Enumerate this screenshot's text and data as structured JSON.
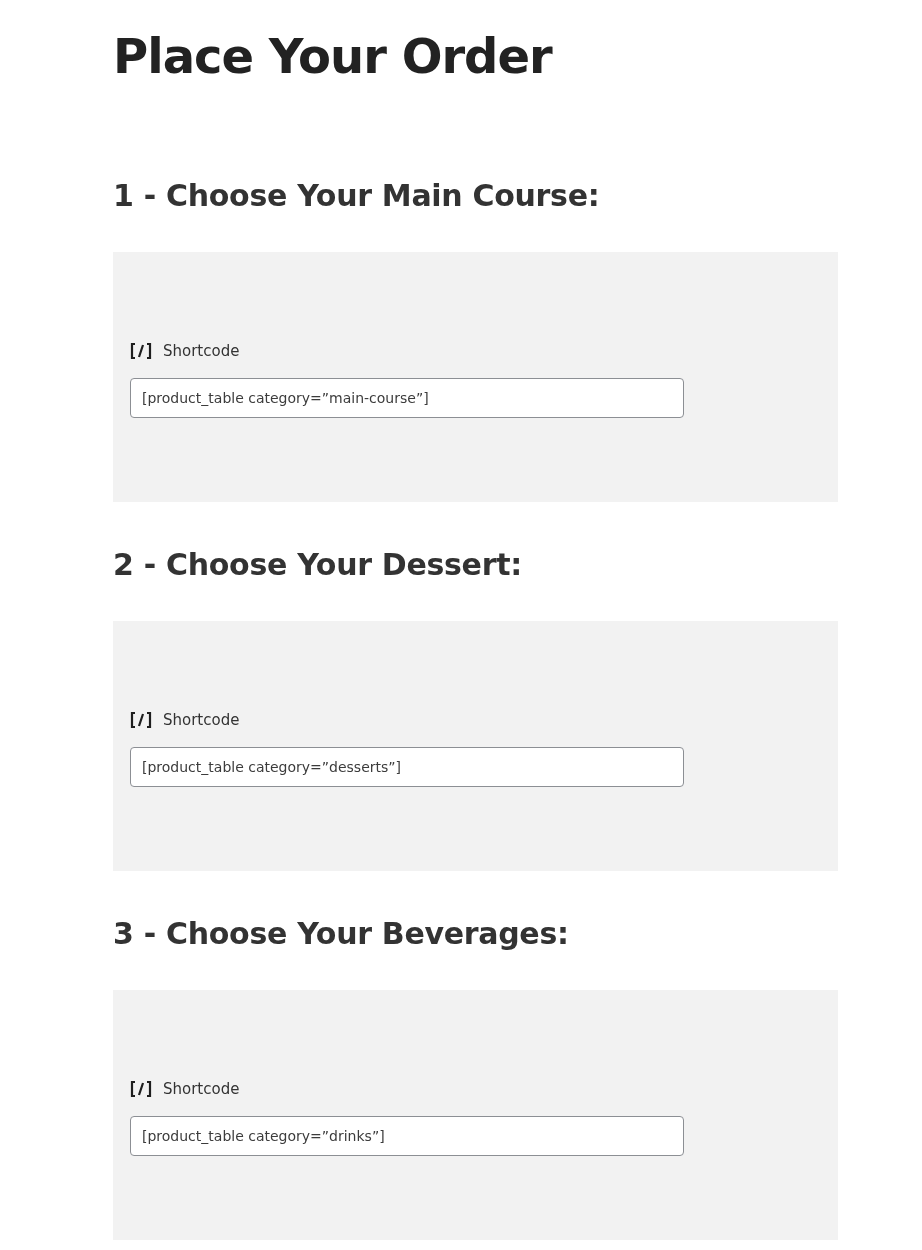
{
  "title": "Place Your Order",
  "sections": [
    {
      "heading": "1 - Choose Your Main Course:",
      "block": {
        "label": "Shortcode",
        "value": "[product_table category=”main-course”]"
      }
    },
    {
      "heading": "2 - Choose Your Dessert:",
      "block": {
        "label": "Shortcode",
        "value": "[product_table category=”desserts”]"
      }
    },
    {
      "heading": "3 - Choose Your Beverages:",
      "block": {
        "label": "Shortcode",
        "value": "[product_table category=”drinks”]"
      }
    }
  ]
}
